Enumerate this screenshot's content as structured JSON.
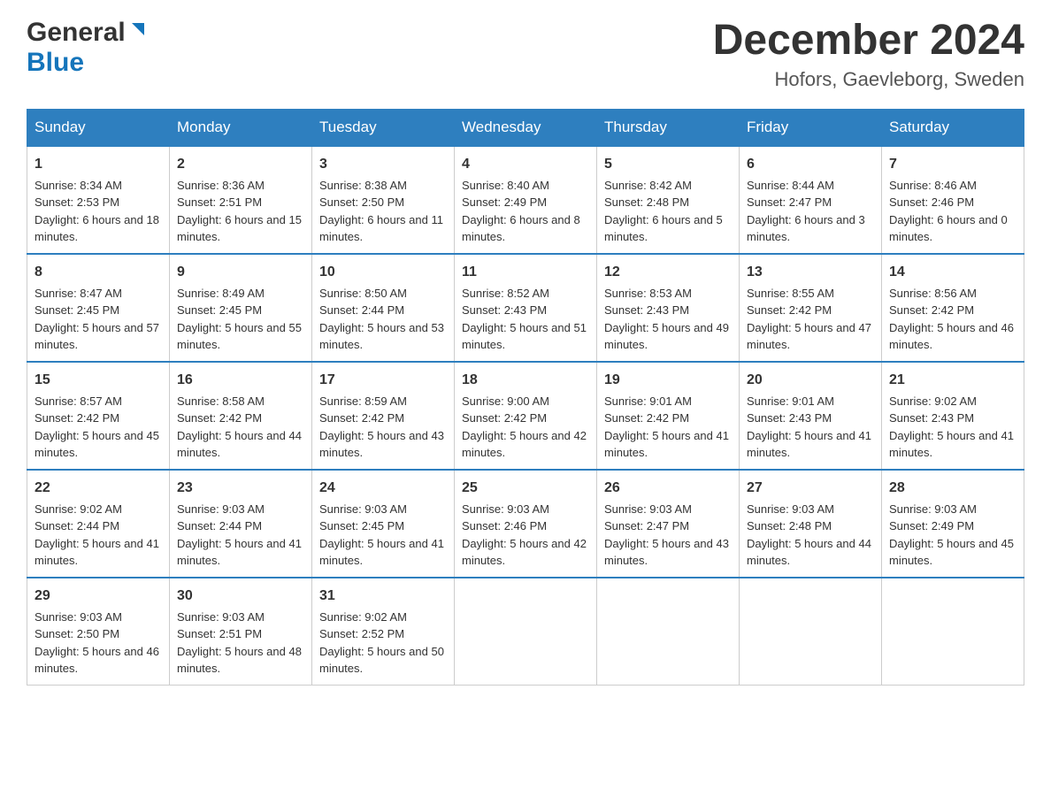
{
  "header": {
    "logo_general": "General",
    "logo_blue": "Blue",
    "title": "December 2024",
    "subtitle": "Hofors, Gaevleborg, Sweden"
  },
  "days_of_week": [
    "Sunday",
    "Monday",
    "Tuesday",
    "Wednesday",
    "Thursday",
    "Friday",
    "Saturday"
  ],
  "weeks": [
    [
      {
        "num": "1",
        "sunrise": "8:34 AM",
        "sunset": "2:53 PM",
        "daylight": "6 hours and 18 minutes."
      },
      {
        "num": "2",
        "sunrise": "8:36 AM",
        "sunset": "2:51 PM",
        "daylight": "6 hours and 15 minutes."
      },
      {
        "num": "3",
        "sunrise": "8:38 AM",
        "sunset": "2:50 PM",
        "daylight": "6 hours and 11 minutes."
      },
      {
        "num": "4",
        "sunrise": "8:40 AM",
        "sunset": "2:49 PM",
        "daylight": "6 hours and 8 minutes."
      },
      {
        "num": "5",
        "sunrise": "8:42 AM",
        "sunset": "2:48 PM",
        "daylight": "6 hours and 5 minutes."
      },
      {
        "num": "6",
        "sunrise": "8:44 AM",
        "sunset": "2:47 PM",
        "daylight": "6 hours and 3 minutes."
      },
      {
        "num": "7",
        "sunrise": "8:46 AM",
        "sunset": "2:46 PM",
        "daylight": "6 hours and 0 minutes."
      }
    ],
    [
      {
        "num": "8",
        "sunrise": "8:47 AM",
        "sunset": "2:45 PM",
        "daylight": "5 hours and 57 minutes."
      },
      {
        "num": "9",
        "sunrise": "8:49 AM",
        "sunset": "2:45 PM",
        "daylight": "5 hours and 55 minutes."
      },
      {
        "num": "10",
        "sunrise": "8:50 AM",
        "sunset": "2:44 PM",
        "daylight": "5 hours and 53 minutes."
      },
      {
        "num": "11",
        "sunrise": "8:52 AM",
        "sunset": "2:43 PM",
        "daylight": "5 hours and 51 minutes."
      },
      {
        "num": "12",
        "sunrise": "8:53 AM",
        "sunset": "2:43 PM",
        "daylight": "5 hours and 49 minutes."
      },
      {
        "num": "13",
        "sunrise": "8:55 AM",
        "sunset": "2:42 PM",
        "daylight": "5 hours and 47 minutes."
      },
      {
        "num": "14",
        "sunrise": "8:56 AM",
        "sunset": "2:42 PM",
        "daylight": "5 hours and 46 minutes."
      }
    ],
    [
      {
        "num": "15",
        "sunrise": "8:57 AM",
        "sunset": "2:42 PM",
        "daylight": "5 hours and 45 minutes."
      },
      {
        "num": "16",
        "sunrise": "8:58 AM",
        "sunset": "2:42 PM",
        "daylight": "5 hours and 44 minutes."
      },
      {
        "num": "17",
        "sunrise": "8:59 AM",
        "sunset": "2:42 PM",
        "daylight": "5 hours and 43 minutes."
      },
      {
        "num": "18",
        "sunrise": "9:00 AM",
        "sunset": "2:42 PM",
        "daylight": "5 hours and 42 minutes."
      },
      {
        "num": "19",
        "sunrise": "9:01 AM",
        "sunset": "2:42 PM",
        "daylight": "5 hours and 41 minutes."
      },
      {
        "num": "20",
        "sunrise": "9:01 AM",
        "sunset": "2:43 PM",
        "daylight": "5 hours and 41 minutes."
      },
      {
        "num": "21",
        "sunrise": "9:02 AM",
        "sunset": "2:43 PM",
        "daylight": "5 hours and 41 minutes."
      }
    ],
    [
      {
        "num": "22",
        "sunrise": "9:02 AM",
        "sunset": "2:44 PM",
        "daylight": "5 hours and 41 minutes."
      },
      {
        "num": "23",
        "sunrise": "9:03 AM",
        "sunset": "2:44 PM",
        "daylight": "5 hours and 41 minutes."
      },
      {
        "num": "24",
        "sunrise": "9:03 AM",
        "sunset": "2:45 PM",
        "daylight": "5 hours and 41 minutes."
      },
      {
        "num": "25",
        "sunrise": "9:03 AM",
        "sunset": "2:46 PM",
        "daylight": "5 hours and 42 minutes."
      },
      {
        "num": "26",
        "sunrise": "9:03 AM",
        "sunset": "2:47 PM",
        "daylight": "5 hours and 43 minutes."
      },
      {
        "num": "27",
        "sunrise": "9:03 AM",
        "sunset": "2:48 PM",
        "daylight": "5 hours and 44 minutes."
      },
      {
        "num": "28",
        "sunrise": "9:03 AM",
        "sunset": "2:49 PM",
        "daylight": "5 hours and 45 minutes."
      }
    ],
    [
      {
        "num": "29",
        "sunrise": "9:03 AM",
        "sunset": "2:50 PM",
        "daylight": "5 hours and 46 minutes."
      },
      {
        "num": "30",
        "sunrise": "9:03 AM",
        "sunset": "2:51 PM",
        "daylight": "5 hours and 48 minutes."
      },
      {
        "num": "31",
        "sunrise": "9:02 AM",
        "sunset": "2:52 PM",
        "daylight": "5 hours and 50 minutes."
      },
      null,
      null,
      null,
      null
    ]
  ],
  "labels": {
    "sunrise": "Sunrise:",
    "sunset": "Sunset:",
    "daylight": "Daylight:"
  }
}
